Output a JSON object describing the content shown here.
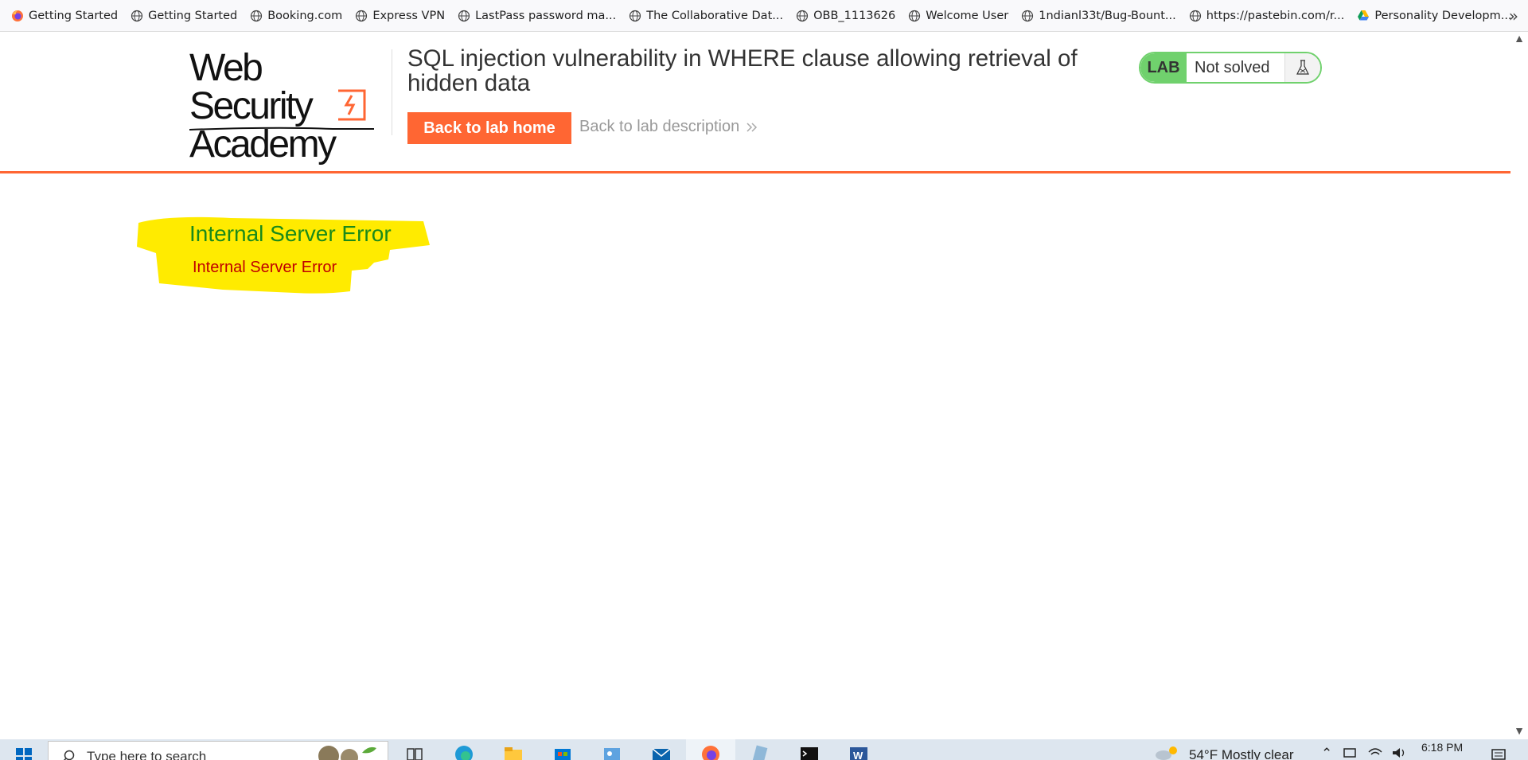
{
  "bookmarks": [
    {
      "label": "Getting Started",
      "icon": "firefox-icon"
    },
    {
      "label": "Getting Started",
      "icon": "globe-icon"
    },
    {
      "label": "Booking.com",
      "icon": "globe-icon"
    },
    {
      "label": "Express VPN",
      "icon": "globe-icon"
    },
    {
      "label": "LastPass password ma...",
      "icon": "globe-icon"
    },
    {
      "label": "The Collaborative Dat...",
      "icon": "globe-icon"
    },
    {
      "label": "OBB_1113626",
      "icon": "globe-icon"
    },
    {
      "label": "Welcome User",
      "icon": "globe-icon"
    },
    {
      "label": "1ndianl33t/Bug-Bount...",
      "icon": "globe-icon"
    },
    {
      "label": "https://pastebin.com/r...",
      "icon": "globe-icon"
    },
    {
      "label": "Personality Developm...",
      "icon": "google-drive-icon"
    }
  ],
  "bookmarks_overflow": "»",
  "logo": {
    "line1": "Web Security",
    "line2": "Academy"
  },
  "lab": {
    "title": "SQL injection vulnerability in WHERE clause allowing retrieval of hidden data",
    "back_home": "Back to lab home",
    "back_description": "Back to lab description",
    "status_badge": "LAB",
    "status_text": "Not solved"
  },
  "error": {
    "heading": "Internal Server Error",
    "message": "Internal Server Error"
  },
  "taskbar": {
    "search_placeholder": "Type here to search",
    "weather": "54°F  Mostly clear",
    "time": "6:18 PM"
  },
  "colors": {
    "accent": "#ff6633",
    "lab_green": "#70d16d",
    "highlight": "#ffeb00",
    "error_heading": "#1a8a1a",
    "error_text": "#c00000"
  }
}
